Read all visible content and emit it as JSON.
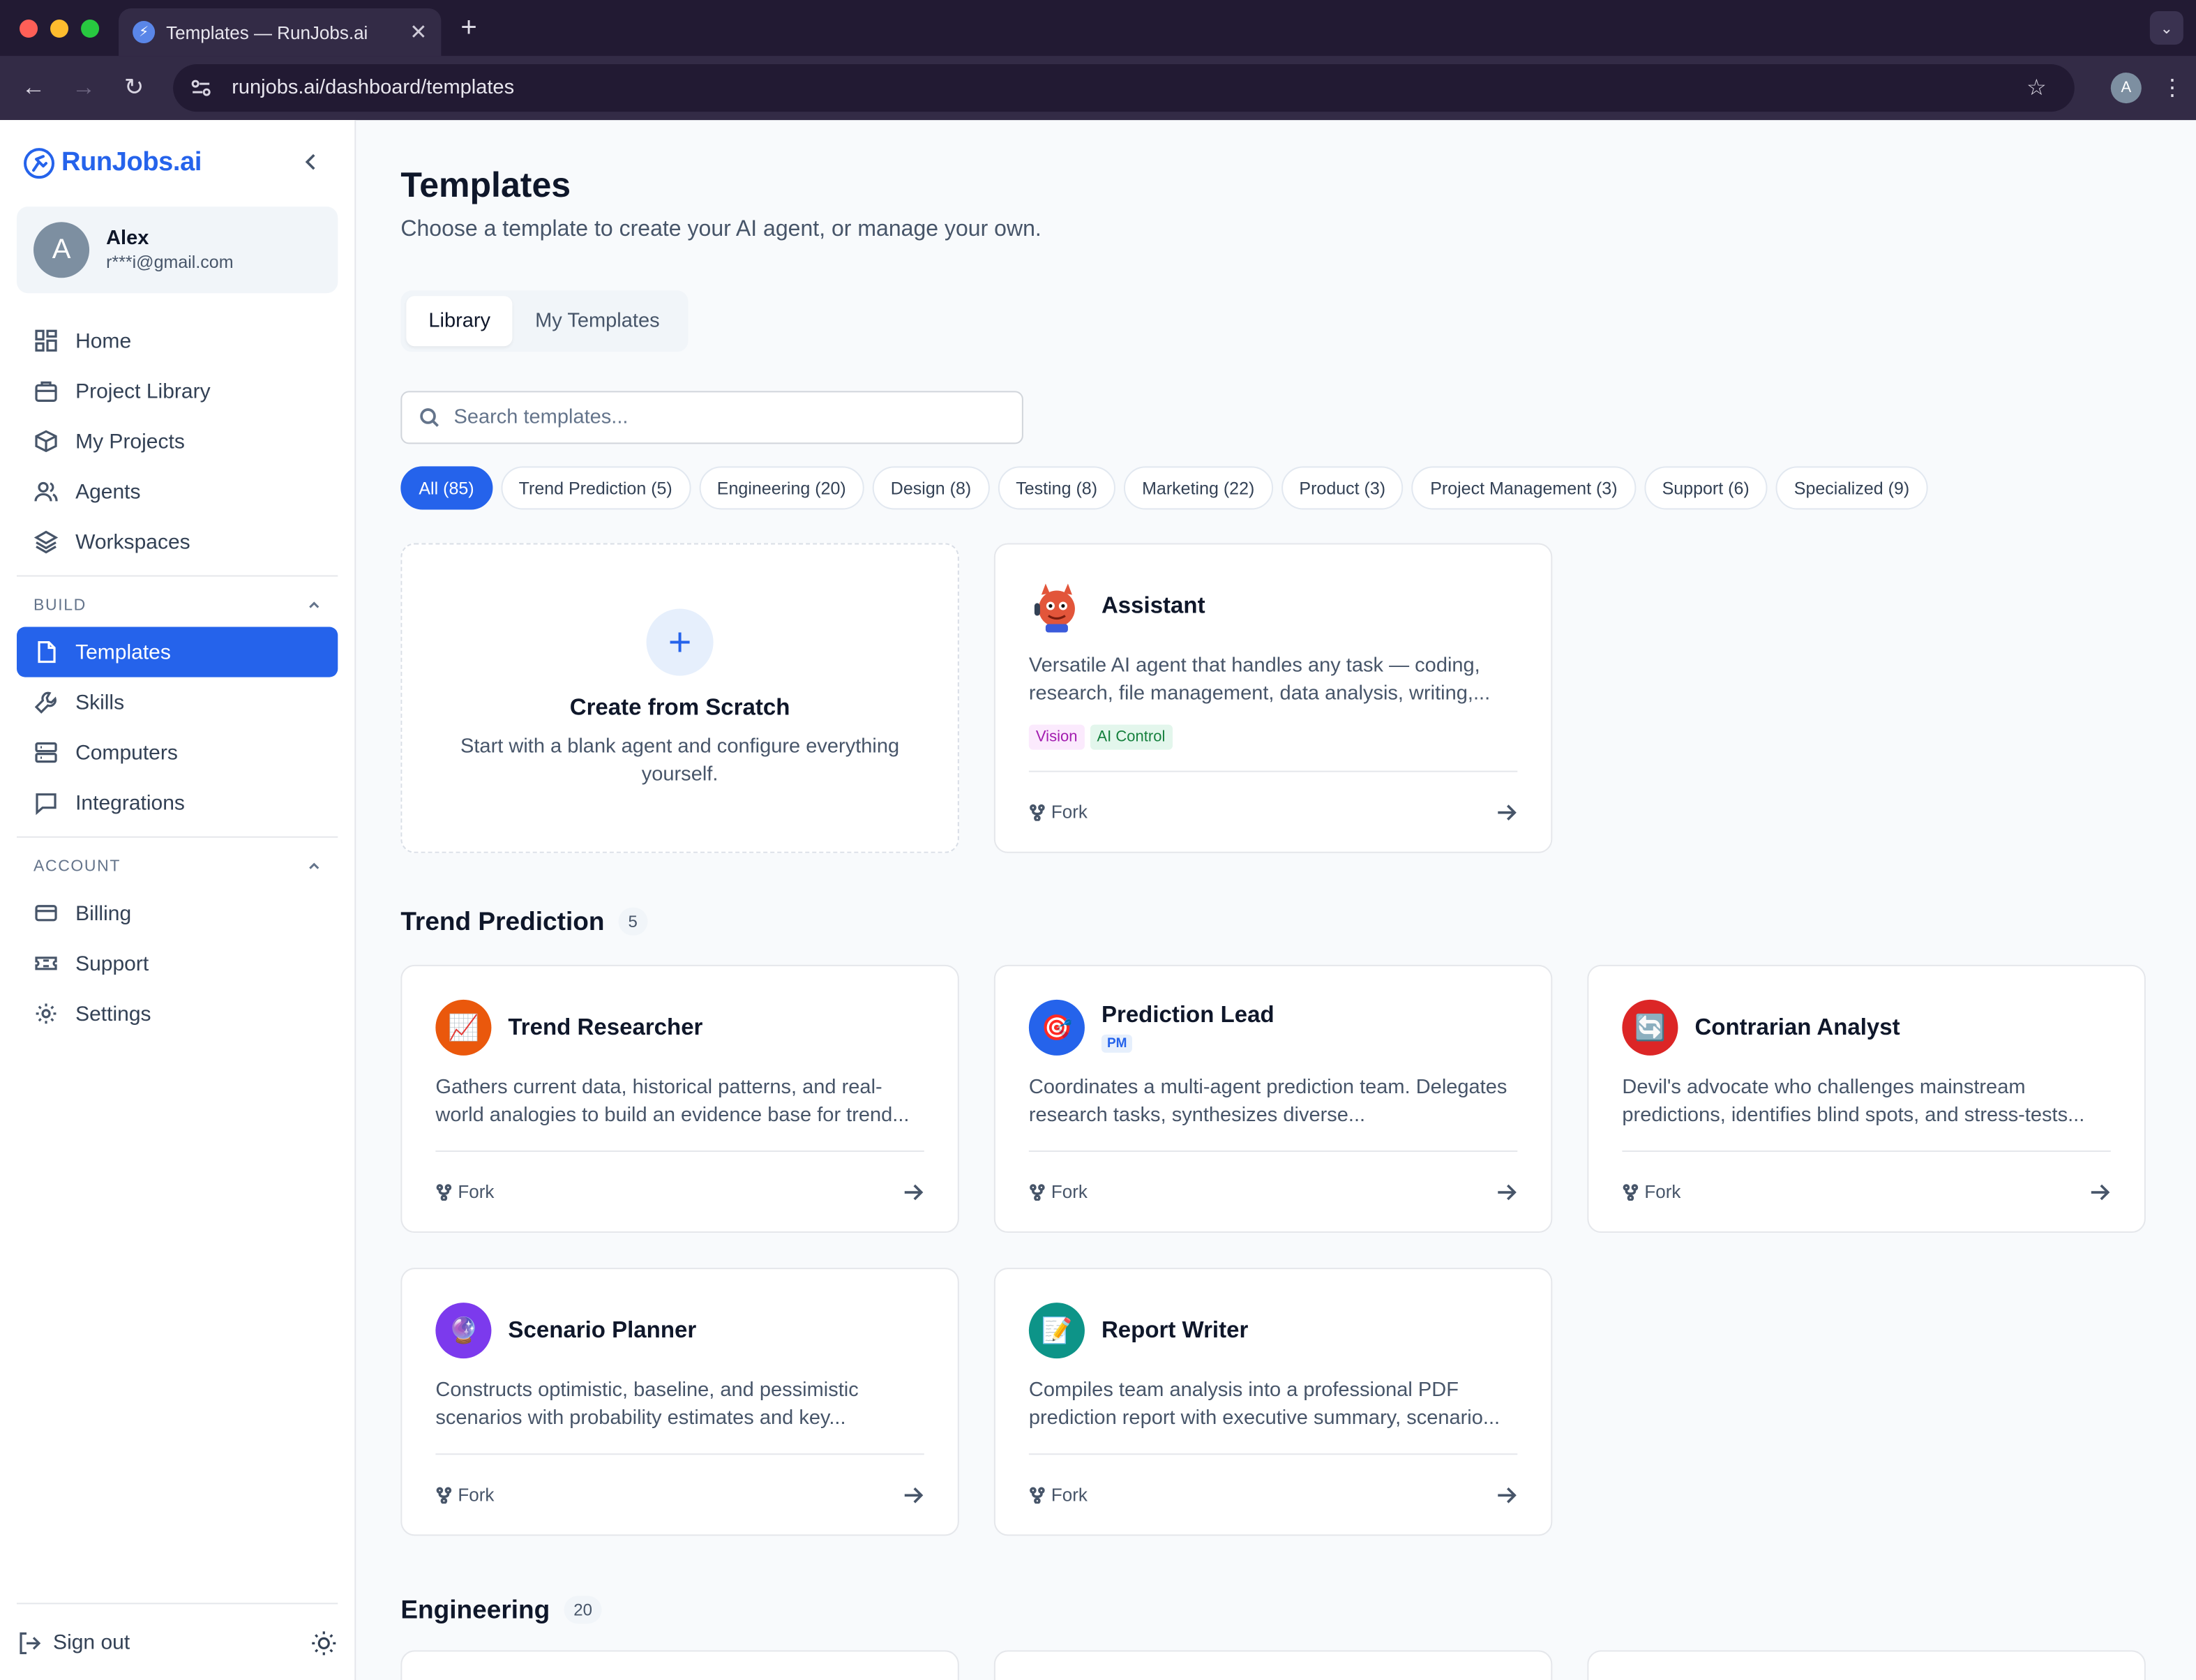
{
  "browser": {
    "tab_title": "Templates — RunJobs.ai",
    "url": "runjobs.ai/dashboard/templates",
    "profile_initial": "A"
  },
  "sidebar": {
    "brand": "RunJobs.ai",
    "user": {
      "initial": "A",
      "name": "Alex",
      "email": "r***i@gmail.com"
    },
    "main_items": [
      {
        "label": "Home",
        "icon": "home-grid-icon"
      },
      {
        "label": "Project Library",
        "icon": "briefcase-icon"
      },
      {
        "label": "My Projects",
        "icon": "box-icon"
      },
      {
        "label": "Agents",
        "icon": "users-icon"
      },
      {
        "label": "Workspaces",
        "icon": "layers-icon"
      }
    ],
    "build_label": "BUILD",
    "build_items": [
      {
        "label": "Templates",
        "icon": "file-icon",
        "active": true
      },
      {
        "label": "Skills",
        "icon": "wrench-icon"
      },
      {
        "label": "Computers",
        "icon": "server-icon"
      },
      {
        "label": "Integrations",
        "icon": "message-square-icon"
      }
    ],
    "account_label": "ACCOUNT",
    "account_items": [
      {
        "label": "Billing",
        "icon": "credit-card-icon"
      },
      {
        "label": "Support",
        "icon": "ticket-icon"
      },
      {
        "label": "Settings",
        "icon": "gear-icon"
      }
    ],
    "sign_out": "Sign out"
  },
  "main": {
    "title": "Templates",
    "subtitle": "Choose a template to create your AI agent, or manage your own.",
    "tabs": [
      {
        "label": "Library",
        "active": true
      },
      {
        "label": "My Templates",
        "active": false
      }
    ],
    "search_placeholder": "Search templates...",
    "filters": [
      "All (85)",
      "Trend Prediction (5)",
      "Engineering (20)",
      "Design (8)",
      "Testing (8)",
      "Marketing (22)",
      "Product (3)",
      "Project Management (3)",
      "Support (6)",
      "Specialized (9)"
    ],
    "scratch": {
      "title": "Create from Scratch",
      "desc": "Start with a blank agent and configure everything yourself."
    },
    "assistant": {
      "title": "Assistant",
      "desc": "Versatile AI agent that handles any task — coding, research, file management, data analysis, writing,...",
      "tags": [
        "Vision",
        "AI Control"
      ]
    },
    "fork_label": "Fork",
    "sections": [
      {
        "name": "Trend Prediction",
        "count": "5",
        "cards": [
          {
            "title": "Trend Researcher",
            "desc": "Gathers current data, historical patterns, and real-world analogies to build an evidence base for trend...",
            "emoji": "📈",
            "color": "#ea580c"
          },
          {
            "title": "Prediction Lead",
            "badge": "PM",
            "desc": "Coordinates a multi-agent prediction team. Delegates research tasks, synthesizes diverse...",
            "emoji": "🎯",
            "color": "#2563eb"
          },
          {
            "title": "Contrarian Analyst",
            "desc": "Devil's advocate who challenges mainstream predictions, identifies blind spots, and stress-tests...",
            "emoji": "🔄",
            "color": "#dc2626"
          },
          {
            "title": "Scenario Planner",
            "desc": "Constructs optimistic, baseline, and pessimistic scenarios with probability estimates and key...",
            "emoji": "🔮",
            "color": "#7c3aed"
          },
          {
            "title": "Report Writer",
            "desc": "Compiles team analysis into a professional PDF prediction report with executive summary, scenario...",
            "emoji": "📝",
            "color": "#0d9488"
          }
        ]
      },
      {
        "name": "Engineering",
        "count": "20"
      }
    ],
    "accent": "#2563eb"
  }
}
